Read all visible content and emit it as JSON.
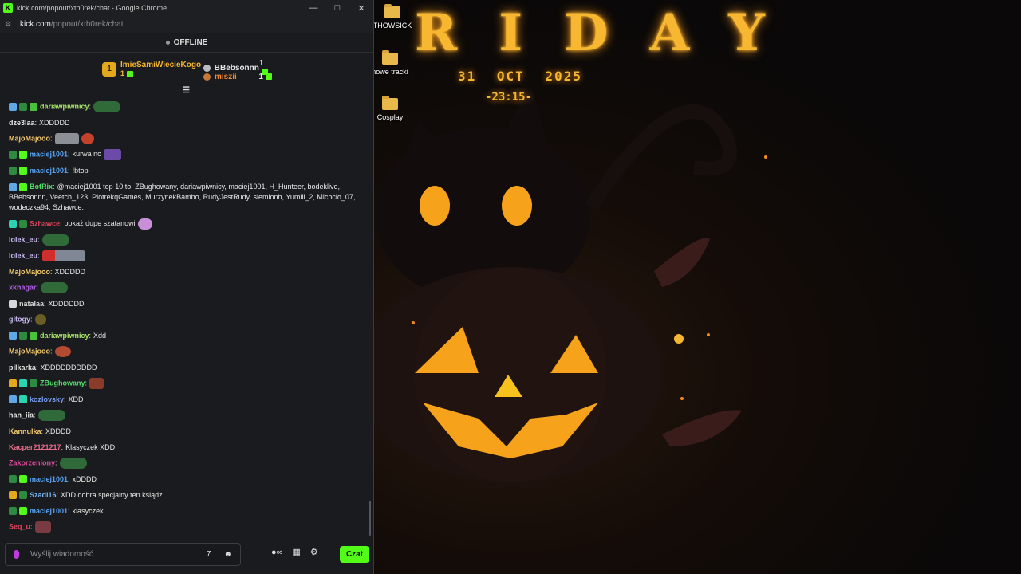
{
  "window": {
    "title": "kick.com/popout/xth0rek/chat - Google Chrome",
    "logo_letter": "K",
    "minimize": "—",
    "maximize": "□",
    "close": "✕"
  },
  "address": {
    "host": "kick.com",
    "path": "/popout/xth0rek/chat"
  },
  "stream_status": "OFFLINE",
  "leaderboard": {
    "first": {
      "rank": "1",
      "name": "ImieSamiWiecieKogo",
      "count": "1"
    },
    "others": [
      {
        "name": "BBebsonnn",
        "count": "1",
        "name_color": "#e6e6e6",
        "icon_color": "#b9bcc2"
      },
      {
        "name": "miszii",
        "count": "1",
        "name_color": "#f08a30",
        "icon_color": "#c8773a"
      }
    ]
  },
  "messages": [
    {
      "user": "dariawpiwnicy",
      "color": "#a8e36c",
      "text": "",
      "badges": [
        "#5fa8e8",
        "#2e8a3e",
        "#49c03a"
      ],
      "emotes": [
        "e-green"
      ]
    },
    {
      "user": "dze3laa",
      "color": "#e6e6e6",
      "text": "XDDDDD",
      "badges": [],
      "emotes": []
    },
    {
      "user": "MajoMajooo",
      "color": "#f3c86a",
      "text": "",
      "badges": [],
      "emotes": [
        "e-gray",
        "e-red"
      ]
    },
    {
      "user": "maciej1001",
      "color": "#5aa4f5",
      "text": "kurwa no",
      "badges": [
        "#2e8a3e",
        "#53fc18"
      ],
      "emotes": [
        "e-purple"
      ]
    },
    {
      "user": "maciej1001",
      "color": "#5aa4f5",
      "text": "!btop",
      "badges": [
        "#2e8a3e",
        "#53fc18"
      ],
      "emotes": []
    },
    {
      "user": "BotRix",
      "color": "#53e06a",
      "text": "@maciej1001 top 10 to: ZBughowany, dariawpiwnicy, maciej1001, H_Hunteer, bodeklive, BBebsonnn, Veetch_123, PiotrekqGames, MurzynekBambo, RudyJestRudy, siemionh, Yumiii_2, Michcio_07, wodeczka94, Szhawce.",
      "badges": [
        "#5fa8e8",
        "#53fc18"
      ],
      "emotes": [],
      "multi": true
    },
    {
      "user": "Szhawce",
      "color": "#e0435a",
      "text": "pokaż dupe szatanowi",
      "badges": [
        "#2bd4b0",
        "#2e8a3e"
      ],
      "emotes": [
        "e-pinkcloud"
      ]
    },
    {
      "user": "lolek_eu",
      "color": "#c9b8f2",
      "text": "",
      "badges": [],
      "emotes": [
        "e-green"
      ]
    },
    {
      "user": "lolek_eu",
      "color": "#c9b8f2",
      "text": "",
      "badges": [],
      "emotes": [
        "e-w"
      ]
    },
    {
      "user": "MajoMajooo",
      "color": "#f3c86a",
      "text": "XDDDDD",
      "badges": [],
      "emotes": []
    },
    {
      "user": "xkhagar",
      "color": "#b45ee8",
      "text": "",
      "badges": [],
      "emotes": [
        "e-green"
      ]
    },
    {
      "user": "natalaa",
      "color": "#d8d8d8",
      "text": "XDDDDDD",
      "badges": [
        "#d8d8d8"
      ],
      "emotes": []
    },
    {
      "user": "gitogy",
      "color": "#c9b8f2",
      "text": "",
      "badges": [],
      "emotes": [
        "e-gob"
      ]
    },
    {
      "user": "dariawpiwnicy",
      "color": "#a8e36c",
      "text": "Xdd",
      "badges": [
        "#5fa8e8",
        "#2e8a3e",
        "#49c03a"
      ],
      "emotes": []
    },
    {
      "user": "MajoMajooo",
      "color": "#f3c86a",
      "text": "",
      "badges": [],
      "emotes": [
        "e-bulb"
      ]
    },
    {
      "user": "pilkarka",
      "color": "#e6e6e6",
      "text": "XDDDDDDDDDD",
      "badges": [],
      "emotes": []
    },
    {
      "user": "ZBughowany",
      "color": "#53e06a",
      "text": "",
      "badges": [
        "#e3a81b",
        "#2bd4b0",
        "#2e8a3e"
      ],
      "emotes": [
        "e-darkred"
      ]
    },
    {
      "user": "kozlovsky",
      "color": "#7a9cf0",
      "text": "XDD",
      "badges": [
        "#5fa8e8",
        "#2bd4b0"
      ],
      "emotes": []
    },
    {
      "user": "han_iia",
      "color": "#e6e6e6",
      "text": "",
      "badges": [],
      "emotes": [
        "e-green"
      ]
    },
    {
      "user": "Kannulka",
      "color": "#f3c86a",
      "text": "XDDDD",
      "badges": [],
      "emotes": []
    },
    {
      "user": "Kacper2121217",
      "color": "#e86b8a",
      "text": "Klasyczek XDD",
      "badges": [],
      "emotes": []
    },
    {
      "user": "Zakorzeniony",
      "color": "#e04aa0",
      "text": "",
      "badges": [],
      "emotes": [
        "e-green"
      ]
    },
    {
      "user": "maciej1001",
      "color": "#5aa4f5",
      "text": "xDDDD",
      "badges": [
        "#2e8a3e",
        "#53fc18"
      ],
      "emotes": []
    },
    {
      "user": "Szadi16",
      "color": "#7ab8f5",
      "text": "XDD dobra specjalny ten ksiądz",
      "badges": [
        "#e3a81b",
        "#2e8a3e"
      ],
      "emotes": []
    },
    {
      "user": "maciej1001",
      "color": "#5aa4f5",
      "text": "klasyczek",
      "badges": [
        "#2e8a3e",
        "#53fc18"
      ],
      "emotes": []
    },
    {
      "user": "Seq_u",
      "color": "#e0435a",
      "text": "",
      "badges": [],
      "emotes": [
        "e-red2"
      ]
    }
  ],
  "composer": {
    "placeholder": "Wyślij wiadomość",
    "send_label": "Czat"
  },
  "desktop": {
    "banner": "RIDAY",
    "date": "31 OCT 2025",
    "time": "-23:15-",
    "icons": [
      "THOWSICK",
      "nowe tracki",
      "Cosplay"
    ]
  },
  "colors": {
    "kick_green": "#53fc18",
    "window_bg": "#1a1b1e",
    "accent_orange": "#f7b731"
  }
}
